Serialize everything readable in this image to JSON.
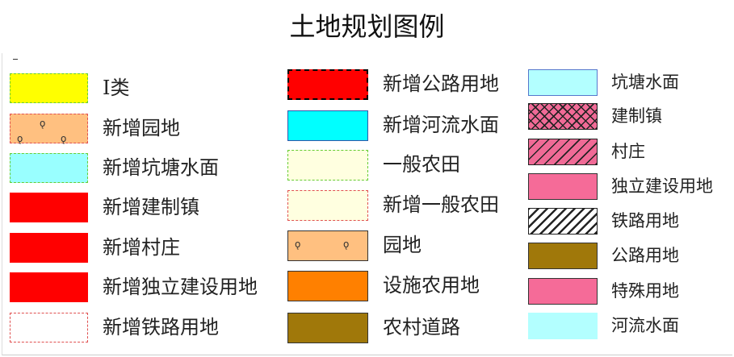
{
  "title": "土地规划图例",
  "columns": [
    {
      "items": [
        {
          "label": "I类",
          "fill": "#ffff00",
          "border": "#66cc33",
          "style": "dashed"
        },
        {
          "label": "新增园地",
          "fill": "#ffc080",
          "border": "#e05050",
          "style": "dashed",
          "pattern": "orchard"
        },
        {
          "label": "新增坑塘水面",
          "fill": "#99ffff",
          "border": "#66cc33",
          "style": "dashed"
        },
        {
          "label": "新增建制镇",
          "fill": "#ff0000",
          "border": "#ff0000",
          "style": "solid"
        },
        {
          "label": "新增村庄",
          "fill": "#ff0000",
          "border": "#ff0000",
          "style": "solid"
        },
        {
          "label": "新增独立建设用地",
          "fill": "#ff0000",
          "border": "#ff0000",
          "style": "solid"
        },
        {
          "label": "新增铁路用地",
          "fill": "#ffffff",
          "border": "#e05050",
          "style": "dashed"
        }
      ]
    },
    {
      "items": [
        {
          "label": "新增公路用地",
          "fill": "#ff0000",
          "border": "#000000",
          "style": "dashed"
        },
        {
          "label": "新增河流水面",
          "fill": "#00ffff",
          "border": "#3355aa",
          "style": "solid"
        },
        {
          "label": "一般农田",
          "fill": "#ffffe0",
          "border": "#66cc33",
          "style": "dashed"
        },
        {
          "label": "新增一般农田",
          "fill": "#ffffe0",
          "border": "#e05050",
          "style": "dashed"
        },
        {
          "label": "园地",
          "fill": "#ffc080",
          "border": "#333333",
          "style": "solid",
          "pattern": "orchard"
        },
        {
          "label": "设施农用地",
          "fill": "#ff8000",
          "border": "#333333",
          "style": "solid"
        },
        {
          "label": "农村道路",
          "fill": "#a0780a",
          "border": "#333333",
          "style": "solid"
        }
      ]
    },
    {
      "items": [
        {
          "label": "坑塘水面",
          "fill": "#b3ffff",
          "border": "#5577cc",
          "style": "solid"
        },
        {
          "label": "建制镇",
          "fill": "#f06a96",
          "border": "#222222",
          "style": "solid",
          "pattern": "cross-hatch"
        },
        {
          "label": "村庄",
          "fill": "#f06a96",
          "border": "#222222",
          "style": "solid",
          "pattern": "single-hatch"
        },
        {
          "label": "独立建设用地",
          "fill": "#f56b98",
          "border": "#333333",
          "style": "solid"
        },
        {
          "label": "铁路用地",
          "fill": "#ffffff",
          "border": "#222222",
          "style": "solid",
          "pattern": "rail-hatch"
        },
        {
          "label": "公路用地",
          "fill": "#a0780a",
          "border": "#333333",
          "style": "solid"
        },
        {
          "label": "特殊用地",
          "fill": "#f56b98",
          "border": "#333333",
          "style": "solid"
        },
        {
          "label": "河流水面",
          "fill": "#b3ffff",
          "border": "#b3ffff",
          "style": "solid"
        }
      ]
    }
  ]
}
